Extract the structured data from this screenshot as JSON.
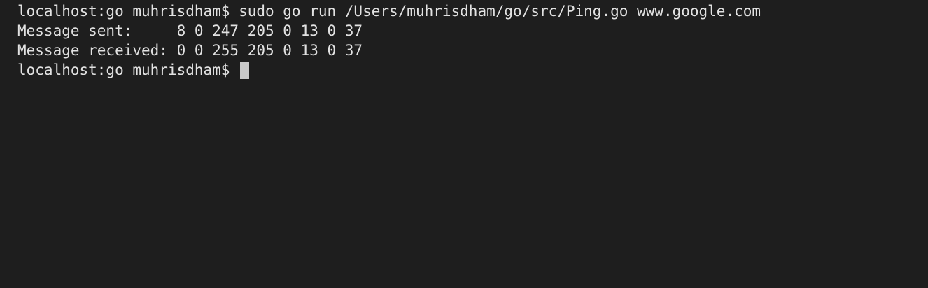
{
  "terminal": {
    "lines": [
      "localhost:go muhrisdham$ sudo go run /Users/muhrisdham/go/src/Ping.go www.google.com",
      "Message sent:     8 0 247 205 0 13 0 37",
      "Message received: 0 0 255 205 0 13 0 37"
    ],
    "prompt": "localhost:go muhrisdham$ ",
    "colors": {
      "background": "#1e1e1e",
      "text": "#e2e2e2",
      "cursor": "#c9c9c9"
    }
  }
}
